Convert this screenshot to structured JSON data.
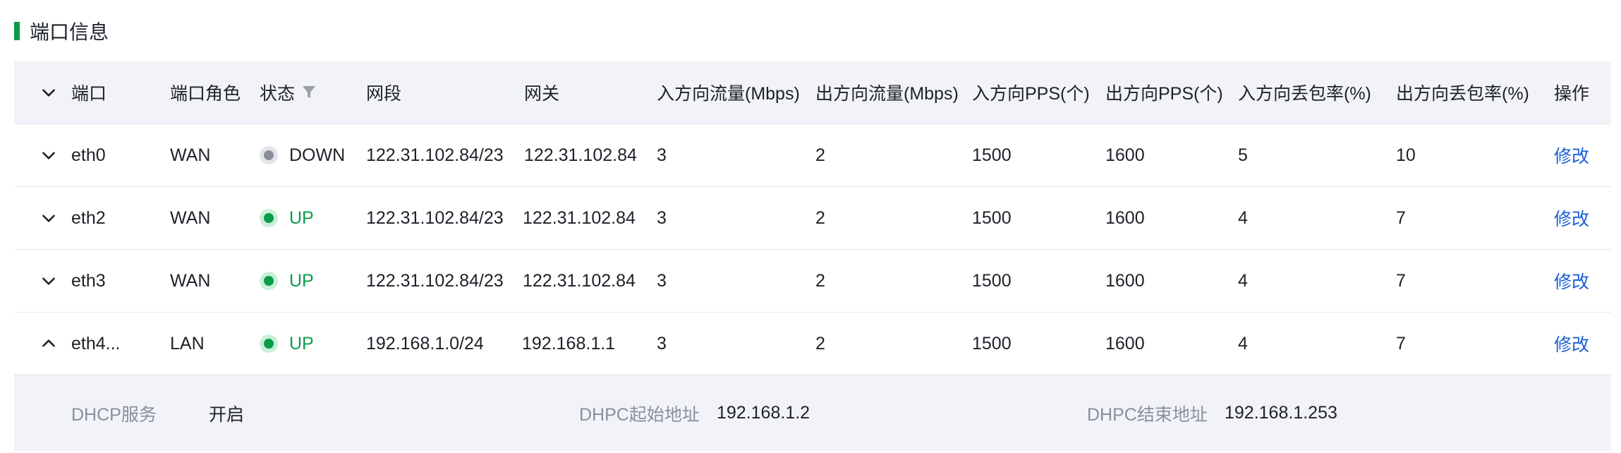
{
  "section": {
    "title": "端口信息"
  },
  "columns": {
    "port": "端口",
    "role": "端口角色",
    "status": "状态",
    "segment": "网段",
    "gateway": "网关",
    "in_traffic": "入方向流量(Mbps)",
    "out_traffic": "出方向流量(Mbps)",
    "in_pps": "入方向PPS(个)",
    "out_pps": "出方向PPS(个)",
    "in_loss": "入方向丢包率(%)",
    "out_loss": "出方向丢包率(%)",
    "action": "操作"
  },
  "rows": [
    {
      "port": "eth0",
      "role": "WAN",
      "status": "DOWN",
      "segment": "122.31.102.84/23",
      "gateway": "122.31.102.84",
      "in_traffic": "3",
      "out_traffic": "2",
      "in_pps": "1500",
      "out_pps": "1600",
      "in_loss": "5",
      "out_loss": "10",
      "action": "修改",
      "expanded": false
    },
    {
      "port": "eth2",
      "role": "WAN",
      "status": "UP",
      "segment": "122.31.102.84/23",
      "gateway": "122.31.102.84",
      "in_traffic": "3",
      "out_traffic": "2",
      "in_pps": "1500",
      "out_pps": "1600",
      "in_loss": "4",
      "out_loss": "7",
      "action": "修改",
      "expanded": false
    },
    {
      "port": "eth3",
      "role": "WAN",
      "status": "UP",
      "segment": "122.31.102.84/23",
      "gateway": "122.31.102.84",
      "in_traffic": "3",
      "out_traffic": "2",
      "in_pps": "1500",
      "out_pps": "1600",
      "in_loss": "4",
      "out_loss": "7",
      "action": "修改",
      "expanded": false
    },
    {
      "port": "eth4...",
      "role": "LAN",
      "status": "UP",
      "segment": "192.168.1.0/24",
      "gateway": "192.168.1.1",
      "in_traffic": "3",
      "out_traffic": "2",
      "in_pps": "1500",
      "out_pps": "1600",
      "in_loss": "4",
      "out_loss": "7",
      "action": "修改",
      "expanded": true
    }
  ],
  "detail": {
    "dhcp_label": "DHCP服务",
    "dhcp_value": "开启",
    "start_label": "DHPC起始地址",
    "start_value": "192.168.1.2",
    "end_label": "DHPC结束地址",
    "end_value": "192.168.1.253"
  },
  "icons": {
    "expand": "chevron-down-icon",
    "collapse": "chevron-up-icon",
    "filter": "filter-icon",
    "status": "status-dot-icon"
  },
  "colors": {
    "accent_green": "#0a9c4a",
    "link_blue": "#1a5fd6",
    "header_bg": "#f2f3f8",
    "down_gray": "#8a8f99"
  }
}
